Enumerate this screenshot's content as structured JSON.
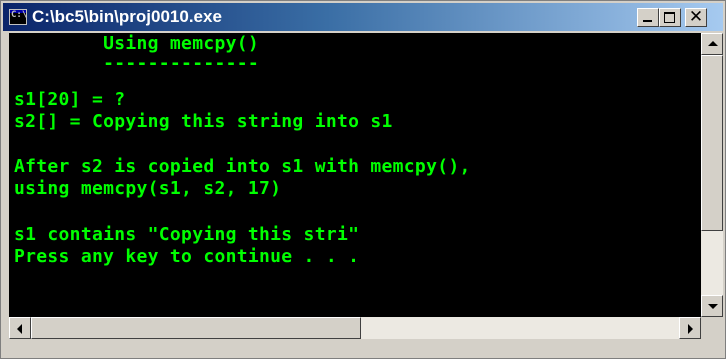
{
  "window": {
    "title": "C:\\bc5\\bin\\proj0010.exe",
    "icon": "console-icon",
    "controls": {
      "minimize": "minimize-icon",
      "maximize": "maximize-icon",
      "close_glyph": "✕"
    }
  },
  "console": {
    "text_color": "#00ff00",
    "background": "#000000",
    "lines": [
      "        Using memcpy()",
      "        --------------",
      "s1[20] = ?",
      "s2[] = Copying this string into s1",
      "After s2 is copied into s1 with memcpy(),",
      "using memcpy(s1, s2, 17)",
      "s1 contains \"Copying this stri\"",
      "Press any key to continue . . ."
    ]
  },
  "scrollbars": {
    "vertical": {
      "up": "arrow-up-icon",
      "down": "arrow-down-icon"
    },
    "horizontal": {
      "left": "arrow-left-icon",
      "right": "arrow-right-icon"
    }
  }
}
